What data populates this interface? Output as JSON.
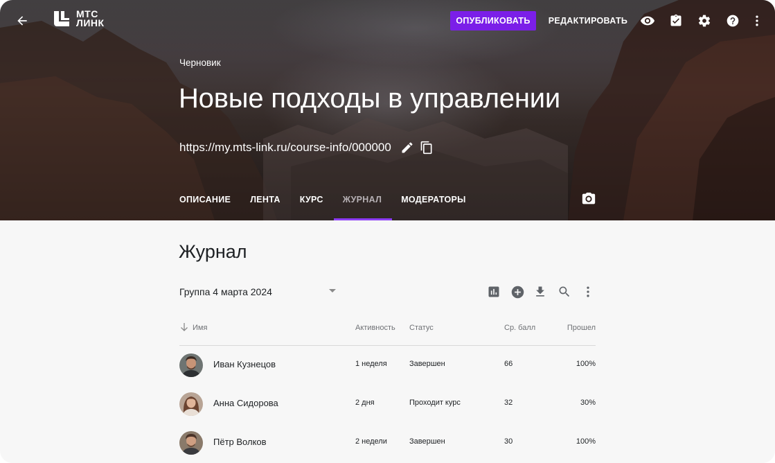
{
  "colors": {
    "accent": "#7b1fe8",
    "tab_indicator": "#8c3cf5",
    "text_primary": "#1d2023",
    "text_secondary": "#6f7175",
    "content_bg": "#f7f7f7"
  },
  "header": {
    "back_icon": "arrow-left-icon",
    "logo": {
      "line1": "МТС",
      "line2": "ЛИНК"
    },
    "publish_label": "ОПУБЛИКОВАТЬ",
    "edit_label": "РЕДАКТИРОВАТЬ",
    "icons": [
      "eye-icon",
      "clipboard-check-icon",
      "gear-icon",
      "help-icon",
      "more-vert-icon"
    ]
  },
  "course": {
    "status": "Черновик",
    "title": "Новые подходы в управлении",
    "url": "https://my.mts-link.ru/course-info/000000",
    "url_icons": [
      "pencil-icon",
      "copy-icon"
    ]
  },
  "tabs": [
    {
      "label": "ОПИСАНИЕ",
      "active": false
    },
    {
      "label": "ЛЕНТА",
      "active": false
    },
    {
      "label": "КУРС",
      "active": false
    },
    {
      "label": "ЖУРНАЛ",
      "active": true
    },
    {
      "label": "МОДЕРАТОРЫ",
      "active": false
    }
  ],
  "journal": {
    "title": "Журнал",
    "group": "Группа 4 марта 2024",
    "toolbar_icons": [
      "bar-chart-icon",
      "add-circle-icon",
      "download-icon",
      "search-icon",
      "more-vert-icon"
    ],
    "columns": {
      "name": "Имя",
      "activity": "Активность",
      "status": "Статус",
      "avg": "Ср. балл",
      "passed": "Прошел"
    },
    "rows": [
      {
        "name": "Иван Кузнецов",
        "activity": "1 неделя",
        "status": "Завершен",
        "avg": "66",
        "passed": "100%"
      },
      {
        "name": "Анна Сидорова",
        "activity": "2 дня",
        "status": "Проходит курс",
        "avg": "32",
        "passed": "30%"
      },
      {
        "name": "Пётр Волков",
        "activity": "2 недели",
        "status": "Завершен",
        "avg": "30",
        "passed": "100%"
      }
    ]
  }
}
